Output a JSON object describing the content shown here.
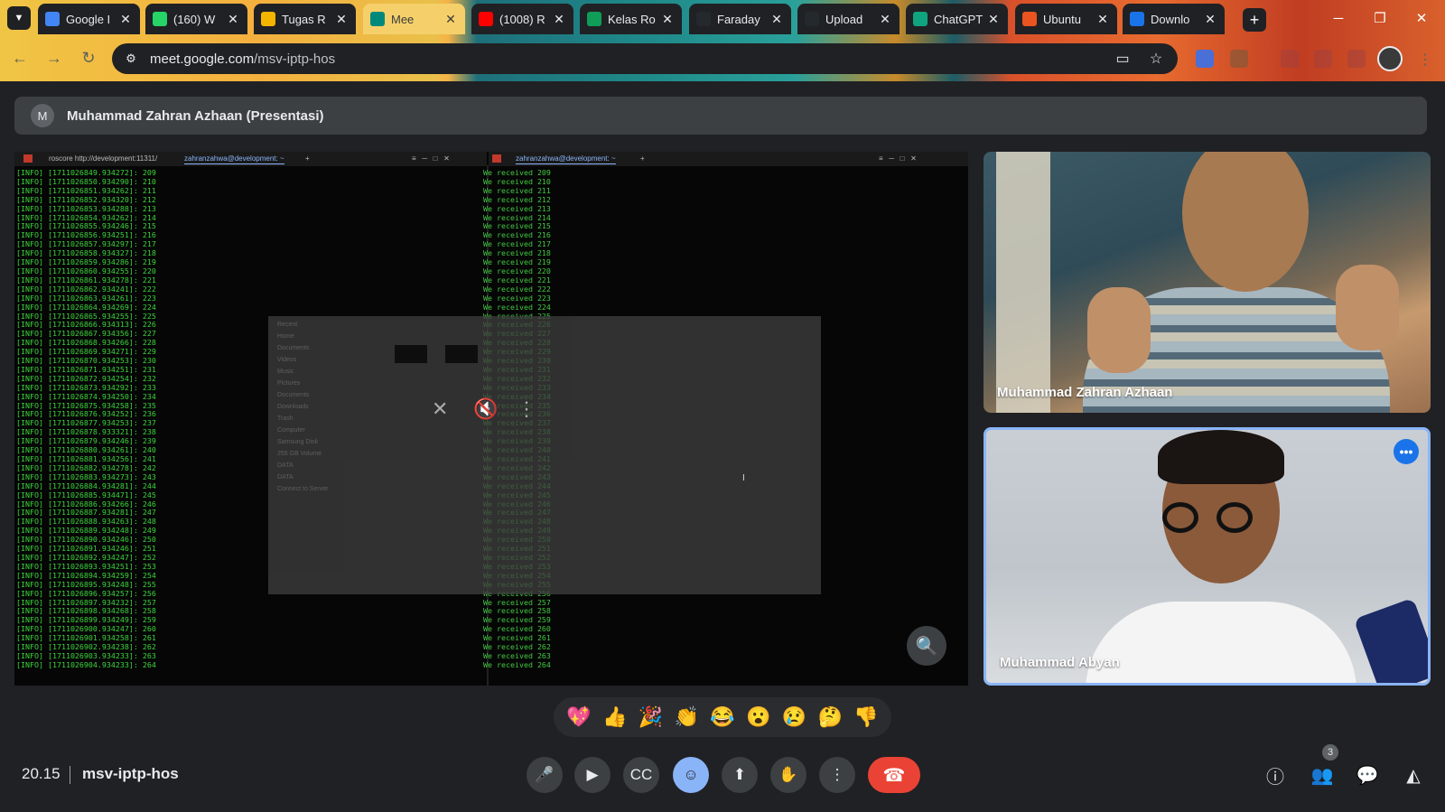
{
  "browser": {
    "tabs": [
      {
        "title": "Google I",
        "icon": "google-icon",
        "color": "#4285f4"
      },
      {
        "title": "(160) W",
        "icon": "whatsapp-icon",
        "color": "#25d366"
      },
      {
        "title": "Tugas R",
        "icon": "slides-icon",
        "color": "#f4b400"
      },
      {
        "title": "Mee",
        "icon": "meet-icon",
        "color": "#00897b"
      },
      {
        "title": "(1008) R",
        "icon": "youtube-icon",
        "color": "#ff0000"
      },
      {
        "title": "Kelas Ro",
        "icon": "sheets-icon",
        "color": "#0f9d58"
      },
      {
        "title": "Faraday",
        "icon": "github-icon",
        "color": "#24292e"
      },
      {
        "title": "Upload",
        "icon": "github-icon",
        "color": "#24292e"
      },
      {
        "title": "ChatGPT",
        "icon": "chatgpt-icon",
        "color": "#10a37f"
      },
      {
        "title": "Ubuntu",
        "icon": "ubuntu-icon",
        "color": "#e95420"
      },
      {
        "title": "Downlo",
        "icon": "download-site-icon",
        "color": "#1a73e8"
      }
    ],
    "url_domain": "meet.google.com",
    "url_path": "/msv-iptp-hos"
  },
  "meet": {
    "presenter_initial": "M",
    "presenter_label": "Muhammad Zahran Azhaan (Presentasi)",
    "participants": [
      {
        "name": "Muhammad Zahran Azhaan"
      },
      {
        "name": "Muhammad Abyan"
      }
    ],
    "reactions": [
      "💖",
      "👍",
      "🎉",
      "👏",
      "😂",
      "😮",
      "😢",
      "🤔",
      "👎"
    ],
    "time": "20.15",
    "meeting_code": "msv-iptp-hos",
    "people_count": "3",
    "accent_color": "#8ab4f8",
    "hangup_color": "#ea4335"
  },
  "shared_screen": {
    "left_tab": "roscore http://development:11311/",
    "left_tab_active": "zahranzahwa@development: ~",
    "right_tab_active": "zahranzahwa@development: ~",
    "talker_lines": [
      "[INFO] [1711026849.934272]: 209",
      "[INFO] [1711026850.934290]: 210",
      "[INFO] [1711026851.934262]: 211",
      "[INFO] [1711026852.934320]: 212",
      "[INFO] [1711026853.934288]: 213",
      "[INFO] [1711026854.934262]: 214",
      "[INFO] [1711026855.934246]: 215",
      "[INFO] [1711026856.934251]: 216",
      "[INFO] [1711026857.934297]: 217",
      "[INFO] [1711026858.934327]: 218",
      "[INFO] [1711026859.934286]: 219",
      "[INFO] [1711026860.934255]: 220",
      "[INFO] [1711026861.934278]: 221",
      "[INFO] [1711026862.934241]: 222",
      "[INFO] [1711026863.934261]: 223",
      "[INFO] [1711026864.934269]: 224",
      "[INFO] [1711026865.934255]: 225",
      "[INFO] [1711026866.934313]: 226",
      "[INFO] [1711026867.934356]: 227",
      "[INFO] [1711026868.934266]: 228",
      "[INFO] [1711026869.934271]: 229",
      "[INFO] [1711026870.934253]: 230",
      "[INFO] [1711026871.934251]: 231",
      "[INFO] [1711026872.934254]: 232",
      "[INFO] [1711026873.934292]: 233",
      "[INFO] [1711026874.934250]: 234",
      "[INFO] [1711026875.934258]: 235",
      "[INFO] [1711026876.934252]: 236",
      "[INFO] [1711026877.934253]: 237",
      "[INFO] [1711026878.933321]: 238",
      "[INFO] [1711026879.934246]: 239",
      "[INFO] [1711026880.934261]: 240",
      "[INFO] [1711026881.934256]: 241",
      "[INFO] [1711026882.934278]: 242",
      "[INFO] [1711026883.934273]: 243",
      "[INFO] [1711026884.934281]: 244",
      "[INFO] [1711026885.934471]: 245",
      "[INFO] [1711026886.934266]: 246",
      "[INFO] [1711026887.934281]: 247",
      "[INFO] [1711026888.934263]: 248",
      "[INFO] [1711026889.934248]: 249",
      "[INFO] [1711026890.934246]: 250",
      "[INFO] [1711026891.934246]: 251",
      "[INFO] [1711026892.934247]: 252",
      "[INFO] [1711026893.934251]: 253",
      "[INFO] [1711026894.934259]: 254",
      "[INFO] [1711026895.934248]: 255",
      "[INFO] [1711026896.934257]: 256",
      "[INFO] [1711026897.934232]: 257",
      "[INFO] [1711026898.934268]: 258",
      "[INFO] [1711026899.934249]: 259",
      "[INFO] [1711026900.934247]: 260",
      "[INFO] [1711026901.934258]: 261",
      "[INFO] [1711026902.934238]: 262",
      "[INFO] [1711026903.934233]: 263",
      "[INFO] [1711026904.934233]: 264"
    ],
    "listener_lines": [
      "We received 209",
      "We received 210",
      "We received 211",
      "We received 212",
      "We received 213",
      "We received 214",
      "We received 215",
      "We received 216",
      "We received 217",
      "We received 218",
      "We received 219",
      "We received 220",
      "We received 221",
      "We received 222",
      "We received 223",
      "We received 224",
      "We received 225",
      "We received 226",
      "We received 227",
      "We received 228",
      "We received 229",
      "We received 230",
      "We received 231",
      "We received 232",
      "We received 233",
      "We received 234",
      "We received 235",
      "We received 236",
      "We received 237",
      "We received 238",
      "We received 239",
      "We received 240",
      "We received 241",
      "We received 242",
      "We received 243",
      "We received 244",
      "We received 245",
      "We received 246",
      "We received 247",
      "We received 248",
      "We received 249",
      "We received 250",
      "We received 251",
      "We received 252",
      "We received 253",
      "We received 254",
      "We received 255",
      "We received 256",
      "We received 257",
      "We received 258",
      "We received 259",
      "We received 260",
      "We received 261",
      "We received 262",
      "We received 263",
      "We received 264"
    ],
    "file_sidebar": [
      "Recent",
      "Home",
      "Documents",
      "Videos",
      "Music",
      "Pictures",
      "Documents",
      "Downloads",
      "Trash",
      "Computer",
      "Samsung Disk",
      "255 GB Volume",
      "DATA",
      "DATA",
      "Connect to Server"
    ]
  }
}
